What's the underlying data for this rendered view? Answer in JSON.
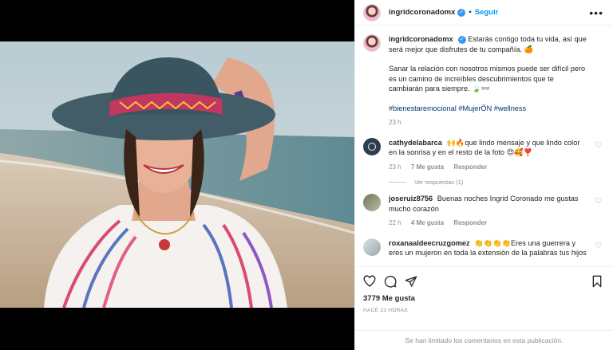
{
  "post": {
    "author": "ingridcoronadomx",
    "follow_label": "Seguir",
    "dot": "•",
    "more_icon": "more-horizontal-icon",
    "caption_line1": "Estarás contigo toda tu vida, así que será mejor que disfrutes de tu compañía. 🍊",
    "caption_line2": "Sanar la relación con nosotros mismos puede ser difícil pero es un camino de increíbles descubrimientos que te cambiarán para siempre. 🍃👓",
    "hashtags": "#bienestaremocional #MujerÖN #wellness",
    "caption_time": "23 h"
  },
  "comments": [
    {
      "user": "cathydelabarca",
      "text": "🙌🔥que lindo mensaje y que lindo color en la sonrisa y en el resto de la foto 😍🥰❣️",
      "time": "23 h",
      "likes": "7 Me gusta",
      "reply": "Responder",
      "view_replies": "Ver respuestas (1)"
    },
    {
      "user": "joseruiz8756",
      "text": "Buenas noches Ingrid Coronado me gustas mucho corazón",
      "time": "22 h",
      "likes": "4 Me gusta",
      "reply": "Responder"
    },
    {
      "user": "roxanaaldeecruzgomez",
      "text": "👏👏👏👏Eres una guerrera y eres un mujeron en toda la extensión de la palabras tus hijos"
    }
  ],
  "actions": {
    "likes": "3779 Me gusta",
    "ago": "HACE 23 HORAS",
    "limited": "Se han limitado los comentarios en esta publicación."
  }
}
